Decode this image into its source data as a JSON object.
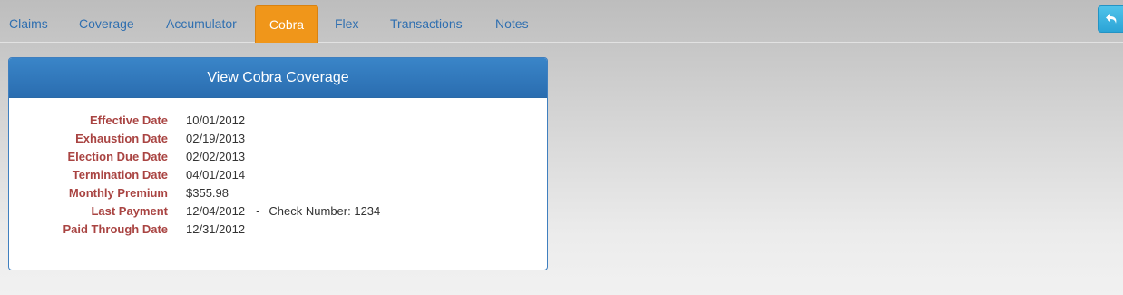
{
  "tabs": [
    {
      "label": "Claims",
      "active": false
    },
    {
      "label": "Coverage",
      "active": false
    },
    {
      "label": "Accumulator",
      "active": false
    },
    {
      "label": "Cobra",
      "active": true
    },
    {
      "label": "Flex",
      "active": false
    },
    {
      "label": "Transactions",
      "active": false
    },
    {
      "label": "Notes",
      "active": false
    }
  ],
  "back_button": {
    "icon": "reply-arrow-icon"
  },
  "panel": {
    "title": "View Cobra Coverage",
    "fields": [
      {
        "label": "Effective Date",
        "value": "10/01/2012"
      },
      {
        "label": "Exhaustion Date",
        "value": "02/19/2013"
      },
      {
        "label": "Election Due Date",
        "value": "02/02/2013"
      },
      {
        "label": "Termination Date",
        "value": "04/01/2014"
      },
      {
        "label": "Monthly Premium",
        "value": "$355.98"
      },
      {
        "label": "Last Payment",
        "value": "12/04/2012",
        "separator": "-",
        "extra": "Check Number: 1234"
      },
      {
        "label": "Paid Through Date",
        "value": "12/31/2012"
      }
    ]
  },
  "colors": {
    "active_tab": "#f0961a",
    "tab_text": "#2f6fb0",
    "panel_header": "#2f78bd",
    "label_text": "#a94442",
    "back_button": "#3bb3e0"
  }
}
